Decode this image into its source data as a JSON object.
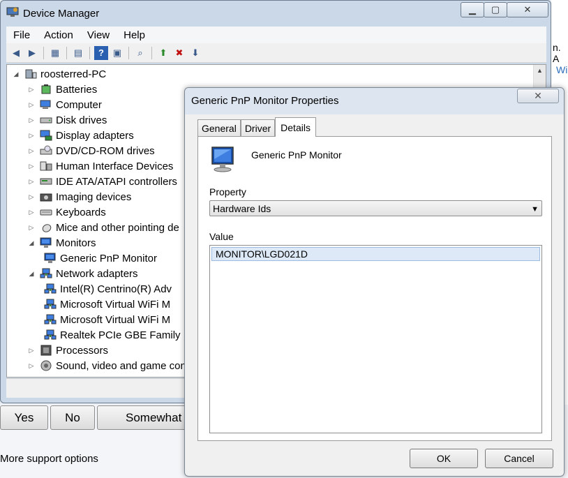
{
  "background": {
    "yes_label": "Yes",
    "no_label": "No",
    "somewhat_label": "Somewhat",
    "support_link": "More support options"
  },
  "device_manager": {
    "title": "Device Manager",
    "menu": [
      "File",
      "Action",
      "View",
      "Help"
    ],
    "tree": {
      "root": "roosterred-PC",
      "items": [
        {
          "label": "Batteries",
          "expanded": false,
          "icon": "battery-icon"
        },
        {
          "label": "Computer",
          "expanded": false,
          "icon": "computer-icon"
        },
        {
          "label": "Disk drives",
          "expanded": false,
          "icon": "disk-icon"
        },
        {
          "label": "Display adapters",
          "expanded": false,
          "icon": "display-adapter-icon"
        },
        {
          "label": "DVD/CD-ROM drives",
          "expanded": false,
          "icon": "dvd-icon"
        },
        {
          "label": "Human Interface Devices",
          "expanded": false,
          "icon": "hid-icon"
        },
        {
          "label": "IDE ATA/ATAPI controllers",
          "expanded": false,
          "icon": "ide-icon"
        },
        {
          "label": "Imaging devices",
          "expanded": false,
          "icon": "camera-icon"
        },
        {
          "label": "Keyboards",
          "expanded": false,
          "icon": "keyboard-icon"
        },
        {
          "label": "Mice and other pointing de",
          "expanded": false,
          "icon": "mouse-icon"
        },
        {
          "label": "Monitors",
          "expanded": true,
          "icon": "monitor-icon"
        },
        {
          "label": "Generic PnP Monitor",
          "child": true,
          "icon": "monitor-icon"
        },
        {
          "label": "Network adapters",
          "expanded": true,
          "icon": "network-icon"
        },
        {
          "label": "Intel(R) Centrino(R) Adv",
          "child": true,
          "icon": "network-icon"
        },
        {
          "label": "Microsoft Virtual WiFi M",
          "child": true,
          "icon": "network-icon"
        },
        {
          "label": "Microsoft Virtual WiFi M",
          "child": true,
          "icon": "network-icon"
        },
        {
          "label": "Realtek PCIe GBE Family",
          "child": true,
          "icon": "network-icon"
        },
        {
          "label": "Processors",
          "expanded": false,
          "icon": "processor-icon"
        },
        {
          "label": "Sound, video and game con",
          "expanded": false,
          "icon": "sound-icon"
        }
      ]
    }
  },
  "dialog": {
    "title": "Generic PnP Monitor Properties",
    "close_glyph": "✕",
    "tabs": [
      "General",
      "Driver",
      "Details"
    ],
    "active_tab": "Details",
    "device_name": "Generic PnP Monitor",
    "property_label": "Property",
    "property_value": "Hardware Ids",
    "value_label": "Value",
    "values": [
      "MONITOR\\LGD021D"
    ],
    "ok_label": "OK",
    "cancel_label": "Cancel"
  }
}
